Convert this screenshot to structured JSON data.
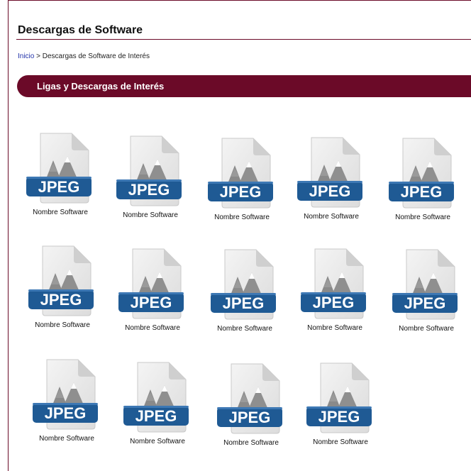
{
  "header": {
    "title": "Descargas de Software"
  },
  "breadcrumb": {
    "home": "Inicio",
    "separator": ">",
    "current": "Descargas de Software de Interés"
  },
  "section": {
    "title": "Ligas y Descargas de Interés"
  },
  "colors": {
    "brand": "#6b0a28",
    "badge": "#1f5a94",
    "link": "#2233aa"
  },
  "files": {
    "icon": "jpeg-file-icon",
    "badge_text": "JPEG",
    "items": [
      {
        "label": "Nombre Software"
      },
      {
        "label": "Nombre Software"
      },
      {
        "label": "Nombre Software"
      },
      {
        "label": "Nombre Software"
      },
      {
        "label": "Nombre Software"
      },
      {
        "label": "Nombre Software"
      },
      {
        "label": "Nombre Software"
      },
      {
        "label": "Nombre Software"
      },
      {
        "label": "Nombre Software"
      },
      {
        "label": "Nombre Software"
      },
      {
        "label": "Nombre Software"
      },
      {
        "label": "Nombre Software"
      },
      {
        "label": "Nombre Software"
      },
      {
        "label": "Nombre Software"
      }
    ]
  }
}
